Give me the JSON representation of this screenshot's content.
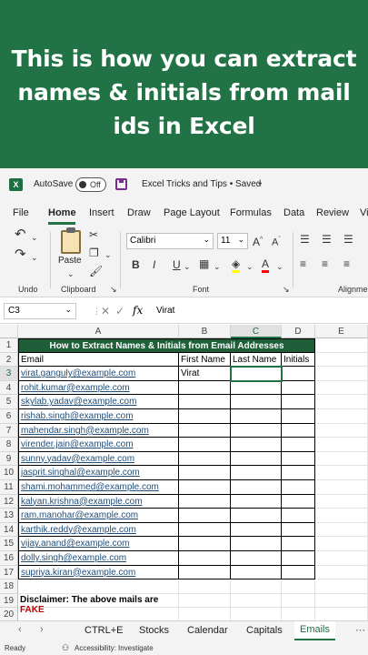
{
  "banner": {
    "line1": "This is how you can extract",
    "line2": "names & initials from mail",
    "line3": "ids in Excel"
  },
  "titlebar": {
    "autosave_label": "AutoSave",
    "autosave_state": "Off",
    "document_title": "Excel Tricks and Tips • Saved",
    "chevron": "⌄"
  },
  "ribbon_tabs": [
    "File",
    "Home",
    "Insert",
    "Draw",
    "Page Layout",
    "Formulas",
    "Data",
    "Review",
    "Vi"
  ],
  "ribbon": {
    "undo_label": "Undo",
    "clipboard_label": "Clipboard",
    "paste_label": "Paste",
    "font_label": "Font",
    "alignment_label": "Alignme",
    "font_name": "Calibri",
    "font_size": "11",
    "bold": "B",
    "italic": "I",
    "underline": "U"
  },
  "formula_bar": {
    "name_box": "C3",
    "fx": "fx",
    "value": "Virat"
  },
  "columns": [
    "A",
    "B",
    "C",
    "D",
    "E"
  ],
  "rows": [
    "1",
    "2",
    "3",
    "4",
    "5",
    "6",
    "7",
    "8",
    "9",
    "10",
    "11",
    "12",
    "13",
    "14",
    "15",
    "16",
    "17",
    "18",
    "19",
    "20"
  ],
  "table": {
    "title": "How to Extract Names & Initials from Email Addresses",
    "headers": [
      "Email",
      "First Name",
      "Last Name",
      "Initials"
    ],
    "emails": [
      "virat.ganguly@example.com",
      "rohit.kumar@example.com",
      "skylab.yadav@example.com",
      "rishab.singh@example.com",
      "mahendar.singh@example.com",
      "virender.jain@example.com",
      "sunny.yadav@example.com",
      "jasprit.singhal@example.com",
      "shami.mohammed@example.com",
      "kalyan.krishna@example.com",
      "ram.manohar@example.com",
      "karthik.reddy@example.com",
      "vijay.anand@example.com",
      "dolly.singh@example.com",
      "supriya.kiran@example.com"
    ],
    "first_name_row3": "Virat"
  },
  "disclaimer": {
    "text": "Disclaimer: The above mails are ",
    "highlight": "FAKE"
  },
  "sheet_tabs": [
    "CTRL+E",
    "Stocks",
    "Calendar",
    "Capitals",
    "Emails"
  ],
  "active_sheet": "Emails",
  "status": {
    "ready": "Ready",
    "accessibility": "Accessibility: Investigate"
  },
  "colors": {
    "banner": "#217346",
    "table_title_bg": "#1e5f3a",
    "accent": "#217346",
    "fake": "#c00000",
    "link": "#1f4e79"
  }
}
